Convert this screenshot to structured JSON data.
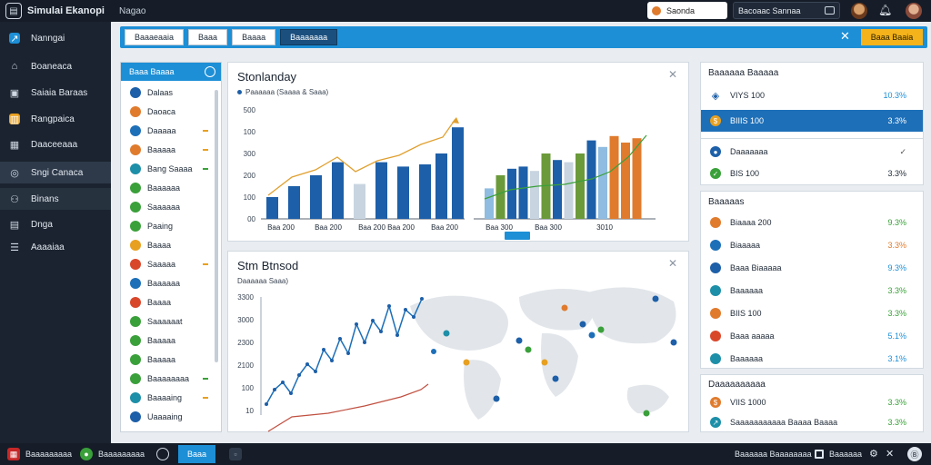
{
  "titlebar": {
    "app_title": "Simulai Ekanopi",
    "menu": "Nagao",
    "search_placeholder": "Saonda",
    "filter_label": "Bacoaac Sannaa"
  },
  "sidebar": {
    "items": [
      {
        "label": "Nanngai",
        "icon": "chart-icon"
      },
      {
        "label": "Boaneaca",
        "icon": "home-icon"
      },
      {
        "label": "Saiaia Baraas",
        "icon": "document-icon"
      },
      {
        "label": "Rangpaica",
        "icon": "bank-icon"
      },
      {
        "label": "Daaceeaaa",
        "icon": "calendar-icon"
      },
      {
        "label": "Sngi Canaca",
        "icon": "globe-icon"
      },
      {
        "label": "Binans",
        "icon": "users-icon"
      },
      {
        "label": "Dnga",
        "icon": "grid-icon"
      },
      {
        "label": "Aaaaiaa",
        "icon": "list-icon"
      }
    ]
  },
  "toolbar": {
    "buttons": [
      "Baaaeaaia",
      "Baaa",
      "Baaaa",
      "Baaaaaaa"
    ],
    "primary": "Baaa Baaia"
  },
  "list_panel": {
    "title": "Baaa Baaaa",
    "items": [
      {
        "label": "Dalaas",
        "color": "#1d5fa8"
      },
      {
        "label": "Daoaca",
        "color": "#e07b2d"
      },
      {
        "label": "Daaaaa",
        "color": "#1d6fb8"
      },
      {
        "label": "Baaaaa",
        "color": "#e07b2d"
      },
      {
        "label": "Bang Saaaa",
        "color": "#1d8fa8"
      },
      {
        "label": "Baaaaaa",
        "color": "#3aa03a"
      },
      {
        "label": "Saaaaaa",
        "color": "#3aa03a"
      },
      {
        "label": "Paaing",
        "color": "#3aa03a"
      },
      {
        "label": "Baaaa",
        "color": "#e8a020"
      },
      {
        "label": "Saaaaa",
        "color": "#d9472b"
      },
      {
        "label": "Baaaaaa",
        "color": "#1d6fb8"
      },
      {
        "label": "Baaaa",
        "color": "#d9472b"
      },
      {
        "label": "Saaaaaat",
        "color": "#3aa03a"
      },
      {
        "label": "Baaaaa",
        "color": "#3aa03a"
      },
      {
        "label": "Baaaaa",
        "color": "#3aa03a"
      },
      {
        "label": "Baaaaaaaa",
        "color": "#3aa03a"
      },
      {
        "label": "Baaaaing",
        "color": "#1d8fa8"
      },
      {
        "label": "Uaaaaing",
        "color": "#1d5fa8"
      }
    ]
  },
  "chart1": {
    "title": "Stonlanday",
    "subtitle": "Paaaaaa (Saaaa & Saaa)"
  },
  "chart2": {
    "title": "Stm Btnsod",
    "subtitle": "Daaaaaa Saaa)"
  },
  "chart_data": [
    {
      "type": "bar",
      "title": "Stonlanday",
      "yticks": [
        "00",
        "100",
        "200",
        "300",
        "100",
        "500"
      ],
      "xticks": [
        "Baa 200",
        "Baa 200",
        "Baa 200",
        "Baa 200",
        "Baa 200",
        "Baa 300",
        "Baa 300",
        "3010"
      ],
      "series": [
        {
          "values": [
            100,
            150,
            200,
            260,
            160,
            260,
            240,
            250,
            300,
            420
          ]
        },
        {
          "values": [
            100,
            200,
            300,
            250,
            340,
            390,
            440,
            480
          ]
        }
      ]
    },
    {
      "type": "line",
      "title": "Stm Btnsod",
      "yticks": [
        "3300",
        "3000",
        "2300",
        "2100",
        "100",
        "10"
      ],
      "series": [
        {
          "values": [
            30,
            70,
            90,
            60,
            110,
            140,
            120,
            180,
            150,
            210,
            170,
            250,
            200,
            260,
            230,
            300,
            220,
            290,
            270,
            320
          ]
        },
        {
          "values": [
            20,
            40,
            70,
            100,
            130,
            160,
            200,
            250
          ]
        }
      ]
    }
  ],
  "right_panels": {
    "p1": {
      "header": "Baaaaaa Baaaaa",
      "rows": [
        {
          "label": "VIYS 100",
          "value": "10.3%"
        },
        {
          "label": "BIIIS 100",
          "value": "3.3%"
        },
        {
          "label": "Daaaaaaa",
          "value": ""
        },
        {
          "label": "BIS 100",
          "value": "3.3%"
        }
      ]
    },
    "p2": {
      "header": "Baaaaas",
      "rows": [
        {
          "label": "Biaaaa 200",
          "value": "9.3%"
        },
        {
          "label": "Biaaaaa",
          "value": "3.3%"
        },
        {
          "label": "Baaa Biaaaaa",
          "value": "9.3%"
        },
        {
          "label": "Baaaaaa",
          "value": "3.3%"
        },
        {
          "label": "BIIS 100",
          "value": "3.3%"
        },
        {
          "label": "Baaa aaaaa",
          "value": "5.1%"
        },
        {
          "label": "Baaaaaa",
          "value": "3.1%"
        }
      ]
    },
    "p3": {
      "header": "Daaaaaaaaaa",
      "rows": [
        {
          "label": "VIIS 1000",
          "value": "3.3%"
        },
        {
          "label": "Saaaaaaaaaaa Baaaa Baaaa",
          "value": "3.3%"
        }
      ]
    }
  },
  "taskbar": {
    "item1": "Baaaaaaaaa",
    "item2": "Baaaaaaaaa",
    "btn": "Baaa",
    "right1": "Baaaaaa Baaaaaaaa",
    "right2": "Baaaaaa"
  }
}
